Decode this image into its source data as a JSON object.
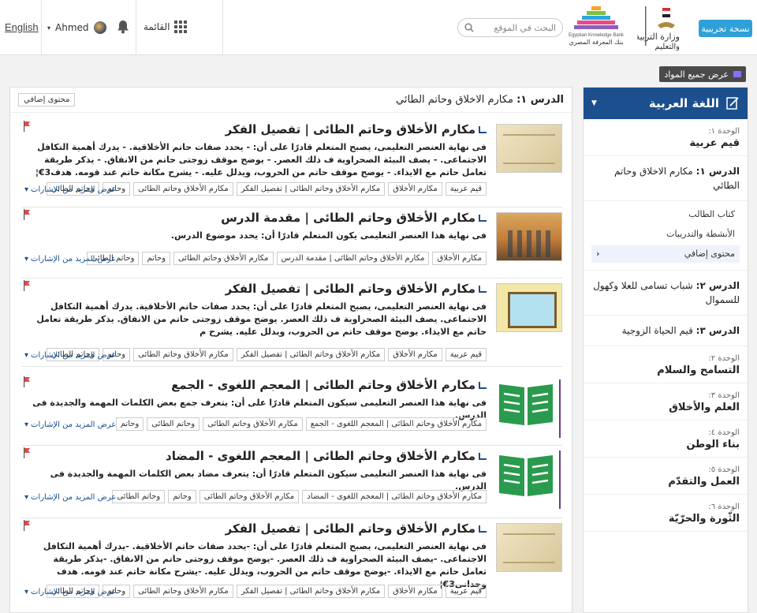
{
  "header": {
    "trial_label": "نسخة تجريبية",
    "ministry_name": "وزارة التربية والتعليم",
    "ekb_name_en": "Egyptian Knowledge Bank",
    "ekb_name_ar": "بنك المعرفة المصري",
    "search_placeholder": "البحث في الموقع",
    "menu_label": "القائمة",
    "user_name": "Ahmed",
    "language": "English"
  },
  "show_all_label": "عرض جميع المواد",
  "sidebar": {
    "subject": "اللغة العربية",
    "unit1_label": "الوحدة ١:",
    "unit1_name": "قيم عربية",
    "lesson1_prefix": "الدرس ١:",
    "lesson1_title": "مكارم الاخلاق وحاتم الطائي",
    "sub_items": [
      "كتاب الطالب",
      "الأنشطة والتدريبات",
      "محتوى إضافي"
    ],
    "lesson2_prefix": "الدرس ٢:",
    "lesson2_title": "شباب تسامى للعلا وكهول للسموال",
    "lesson3_prefix": "الدرس ٣:",
    "lesson3_title": "قيم الحياة الزوجية",
    "units": [
      {
        "label": "الوحدة ٢:",
        "name": "التسامح والسلام"
      },
      {
        "label": "الوحدة ٣:",
        "name": "العلم والأخلاق"
      },
      {
        "label": "الوحدة ٤:",
        "name": "بناء الوطن"
      },
      {
        "label": "الوحدة ٥:",
        "name": "العمل والتقدّم"
      },
      {
        "label": "الوحدة ٦:",
        "name": "الثّورة والحرّيّة"
      }
    ]
  },
  "main": {
    "lesson_prefix": "الدرس ١:",
    "lesson_title": "مكارم الاخلاق وحاتم الطائي",
    "extra_button": "محتوى إضافي",
    "more_label": "عرض المزيد من الإشارات",
    "cards": [
      {
        "title": "مكارم الأخلاق وحاتم الطائى | تفصيل الفكر",
        "desc": "فى نهاية العنصر التعليمى، يصبح المتعلم قادرًا على أن: - يحدد صفات حاتم الأخلاقية. - يدرك أهمية التكافل الاجتماعى. - يصف البيئة الصحراوية ف ذلك العصر. - يوضح موقف زوجتى حاتم من الانفاق. - يذكر طريقة تعامل حاتم مع الايذاء. - يوضح موقف حاتم من الحروب، ويدلل عليه. - يشرح مكانة حاتم عند قومه. هدف3€¦",
        "tags": [
          "قيم عربية",
          "مكارم الأخلاق",
          "مكارم الأخلاق وحاتم الطائى | تفصيل الفكر",
          "مكارم الأخلاق وحاتم الطائى",
          "وحاتم",
          "وحاتم الطائى"
        ]
      },
      {
        "title": "مكارم الأخلاق وحاتم الطائى | مقدمة الدرس",
        "desc": "فى نهاية هذا العنصر التعليمى يكون المتعلم قادرًا أن: يحدد موضوع الدرس.",
        "tags": [
          "مكارم الأخلاق",
          "مكارم الأخلاق وحاتم الطائى | مقدمة الدرس",
          "مكارم الأخلاق وحاتم الطائى",
          "وحاتم",
          "وحاتم الطائى"
        ]
      },
      {
        "title": "مكارم الأخلاق وحاتم الطائى | تفصيل الفكر",
        "desc": "فى نهاية العنصر التعليمى، يصبح المتعلم قادرًا على أن: يحدد صفات حاتم الأخلاقية. يدرك أهمية التكافل الاجتماعى. يصف البيئة الصحراوية ف ذلك العصر. يوضح موقف زوجتى حاتم من الانفاق. يذكر طريقة تعامل حاتم مع الايذاء. يوضح موقف حاتم من الحروب، ويدلل عليه. يشرح م",
        "tags": [
          "قيم عربية",
          "مكارم الأخلاق",
          "مكارم الأخلاق وحاتم الطائى | تفصيل الفكر",
          "مكارم الأخلاق وحاتم الطائى",
          "وحاتم",
          "وحاتم الطائى"
        ]
      },
      {
        "title": "مكارم الأخلاق وحاتم الطائى | المعجم اللغوى - الجمع",
        "desc": "فى نهاية هذا العنصر التعليمى سيكون المتعلم قادرًا على أن: يتعرف جمع بعض الكلمات المهمة والجديدة فى الدرس.",
        "tags": [
          "مكارم الأخلاق وحاتم الطائى | المعجم اللغوى - الجمع",
          "مكارم الأخلاق وحاتم الطائى",
          "وحاتم الطائى",
          "وحاتم"
        ]
      },
      {
        "title": "مكارم الأخلاق وحاتم الطائى | المعجم اللغوى - المضاد",
        "desc": "فى نهاية هذا العنصر التعليمى سيكون المتعلم قادرًا أن: يتعرف مضاد بعض الكلمات المهمة والجديدة فى الدرس.",
        "tags": [
          "مكارم الأخلاق وحاتم الطائى | المعجم اللغوى - المضاد",
          "مكارم الأخلاق وحاتم الطائى",
          "وحاتم",
          "وحاتم الطائى"
        ]
      },
      {
        "title": "مكارم الأخلاق وحاتم الطائى | تفصيل الفكر",
        "desc": "فى نهاية العنصر التعليمى، يصبح المتعلم قادرًا على أن: -يحدد صفات حاتم الأخلاقية. -يدرك أهمية التكافل الاجتماعى. -يصف البيئة الصحراوية ف ذلك العصر. -يوضح موقف زوجتى حاتم من الانفاق. -يذكر طريقة تعامل حاتم مع الايذاء. -يوضح موقف حاتم من الحروب، ويدلل عليه. -يشرح مكانة حاتم عند قومه. هدف وجدانى3€¦",
        "tags": [
          "قيم عربية",
          "مكارم الأخلاق",
          "مكارم الأخلاق وحاتم الطائى | تفصيل الفكر",
          "مكارم الأخلاق وحاتم الطائى",
          "وحاتم",
          "وحاتم الطائى"
        ]
      }
    ]
  }
}
